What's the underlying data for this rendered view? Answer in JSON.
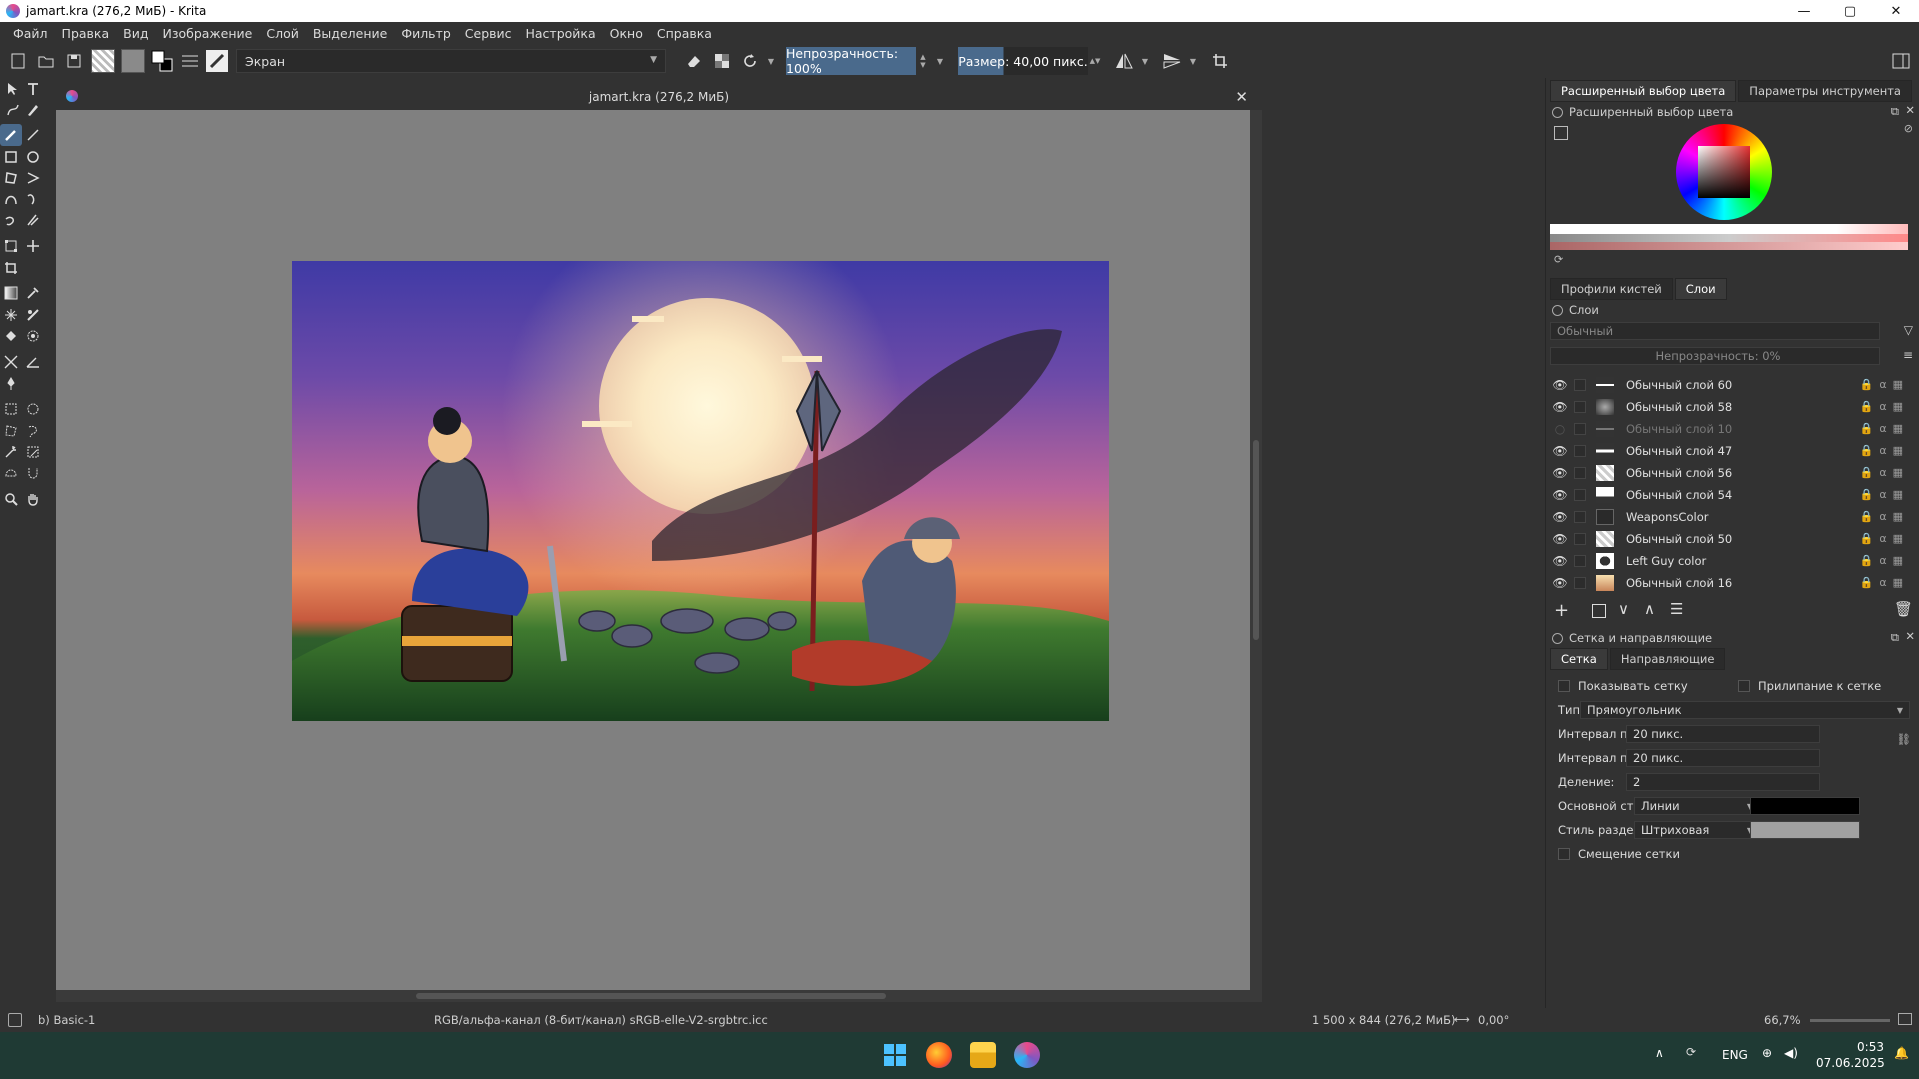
{
  "window": {
    "title": "jamart.kra (276,2 МиБ)  - Krita",
    "controls": [
      "—",
      "▢",
      "✕"
    ]
  },
  "menu": [
    "Файл",
    "Правка",
    "Вид",
    "Изображение",
    "Слой",
    "Выделение",
    "Фильтр",
    "Сервис",
    "Настройка",
    "Окно",
    "Справка"
  ],
  "toolbar": {
    "blend_mode": "Экран",
    "opacity_label": "Непрозрачность: 100%",
    "size_label": "Размер: 40,00 пикс."
  },
  "document": {
    "tab_title": "jamart.kra (276,2 МиБ)"
  },
  "statusbar": {
    "brush": "b) Basic-1",
    "color_space": "RGB/альфа-канал (8-бит/канал)  sRGB-elle-V2-srgbtrc.icc",
    "dimensions": "1 500 x 844 (276,2 МиБ)",
    "rotation": "0,00°",
    "zoom": "66,7%"
  },
  "color_dock": {
    "tabs": [
      "Расширенный выбор цвета",
      "Параметры инструмента"
    ],
    "title": "Расширенный выбор цвета"
  },
  "layers_dock": {
    "tabs": [
      "Профили кистей",
      "Слои"
    ],
    "title": "Слои",
    "blend_mode": "Обычный",
    "opacity": "Непрозрачность:  0%",
    "layers": [
      {
        "name": "Обычный слой 60",
        "visible": true
      },
      {
        "name": "Обычный слой 58",
        "visible": true
      },
      {
        "name": "Обычный слой 10",
        "visible": false
      },
      {
        "name": "Обычный слой 47",
        "visible": true
      },
      {
        "name": "Обычный слой 56",
        "visible": true
      },
      {
        "name": "Обычный слой 54",
        "visible": true
      },
      {
        "name": "WeaponsColor",
        "visible": true
      },
      {
        "name": "Обычный слой 50",
        "visible": true
      },
      {
        "name": "Left Guy color",
        "visible": true
      },
      {
        "name": "Обычный слой 16",
        "visible": true
      }
    ]
  },
  "grid_dock": {
    "title": "Сетка и направляющие",
    "tabs": [
      "Сетка",
      "Направляющие"
    ],
    "show_grid": "Показывать сетку",
    "snap_grid": "Прилипание к сетке",
    "type_label": "Тип:",
    "type_value": "Прямоугольник",
    "x_label": "Интервал по X:",
    "x_value": "20 пикс.",
    "y_label": "Интервал по Y:",
    "y_value": "20 пикс.",
    "div_label": "Деление:",
    "div_value": "2",
    "main_style_label": "Основной стиль:",
    "main_style_value": "Линии",
    "div_style_label": "Стиль раздела:",
    "div_style_value": "Штриховая",
    "offset_label": "Смещение сетки",
    "main_color": "#000000",
    "div_color": "#a0a0a0"
  },
  "taskbar": {
    "lang": "ENG",
    "time": "0:53",
    "date": "07.06.2025"
  }
}
